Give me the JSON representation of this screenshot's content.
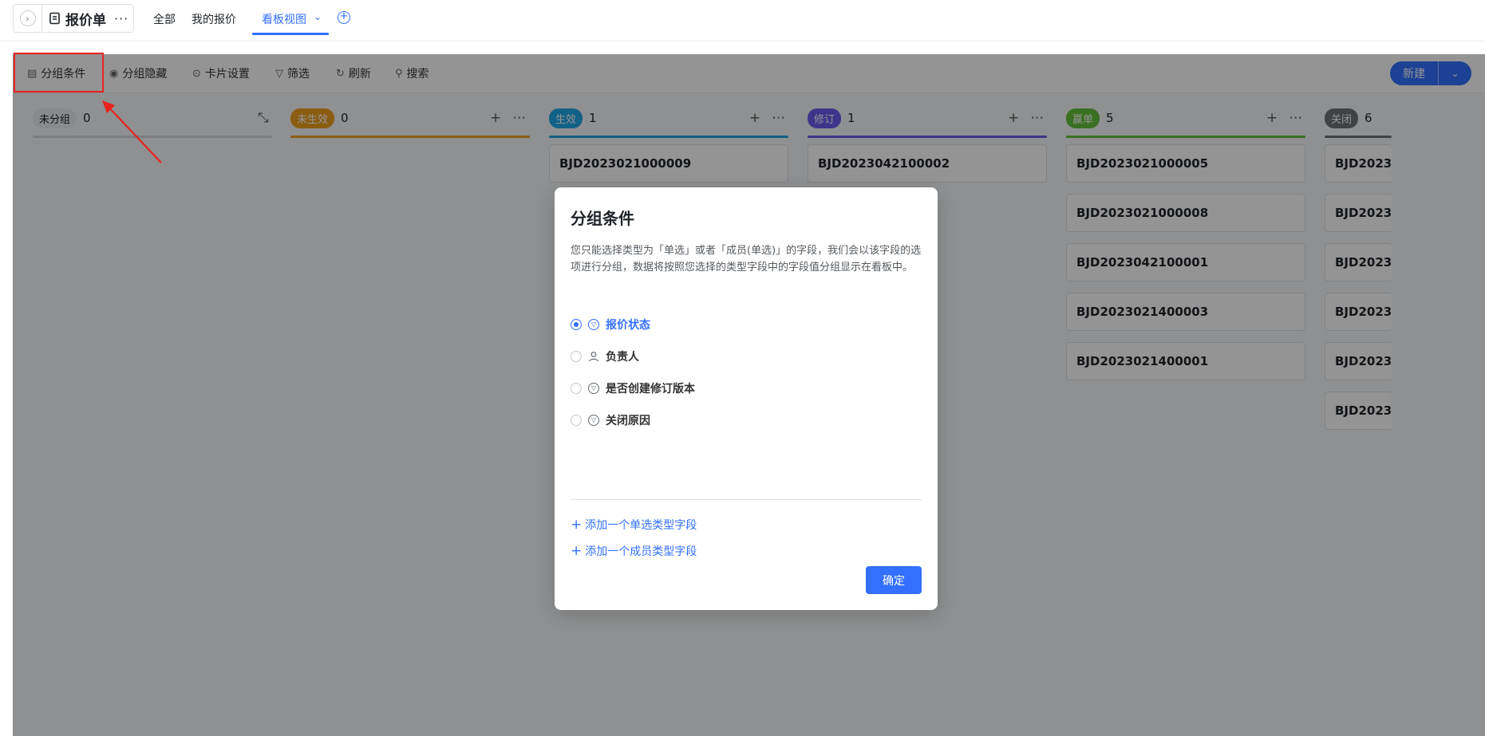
{
  "app": {
    "title": "报价单",
    "more": "···"
  },
  "views": {
    "all": "全部",
    "mine": "我的报价",
    "kanban": "看板视图"
  },
  "toolbar": {
    "group_condition": "分组条件",
    "group_hide": "分组隐藏",
    "card_settings": "卡片设置",
    "filter": "筛选",
    "refresh": "刷新",
    "search": "搜索",
    "new": "新建"
  },
  "columns": [
    {
      "label": "未分组",
      "count": "0",
      "color": "#eceef1",
      "text_color": "#1f2329",
      "line_color": "#d5d8dc",
      "cards": []
    },
    {
      "label": "未生效",
      "count": "0",
      "color": "#f0a020",
      "text_color": "#ffffff",
      "line_color": "#f0a020",
      "cards": []
    },
    {
      "label": "生效",
      "count": "1",
      "color": "#1fa7e8",
      "text_color": "#ffffff",
      "line_color": "#1fa7e8",
      "cards": [
        "BJD2023021000009"
      ]
    },
    {
      "label": "修订",
      "count": "1",
      "color": "#6b5cf0",
      "text_color": "#ffffff",
      "line_color": "#6b5cf0",
      "cards": [
        "BJD2023042100002"
      ]
    },
    {
      "label": "赢单",
      "count": "5",
      "color": "#63c23a",
      "text_color": "#ffffff",
      "line_color": "#63c23a",
      "cards": [
        "BJD2023021000005",
        "BJD2023021000008",
        "BJD2023042100001",
        "BJD2023021400003",
        "BJD2023021400001"
      ]
    },
    {
      "label": "关闭",
      "count": "6",
      "color": "#6e7379",
      "text_color": "#ffffff",
      "line_color": "#6e7379",
      "cards": [
        "BJD2023",
        "BJD2023",
        "BJD2023",
        "BJD2023",
        "BJD2023",
        "BJD2023"
      ]
    }
  ],
  "modal": {
    "title": "分组条件",
    "description": "您只能选择类型为「单选」或者「成员(单选)」的字段，我们会以该字段的选项进行分组，数据将按照您选择的类型字段中的字段值分组显示在看板中。",
    "options": [
      {
        "label": "报价状态",
        "icon": "single-select-icon",
        "selected": true
      },
      {
        "label": "负责人",
        "icon": "member-icon",
        "selected": false
      },
      {
        "label": "是否创建修订版本",
        "icon": "single-select-icon",
        "selected": false
      },
      {
        "label": "关闭原因",
        "icon": "single-select-icon",
        "selected": false
      }
    ],
    "add_single_select": "添加一个单选类型字段",
    "add_member": "添加一个成员类型字段",
    "confirm": "确定"
  }
}
